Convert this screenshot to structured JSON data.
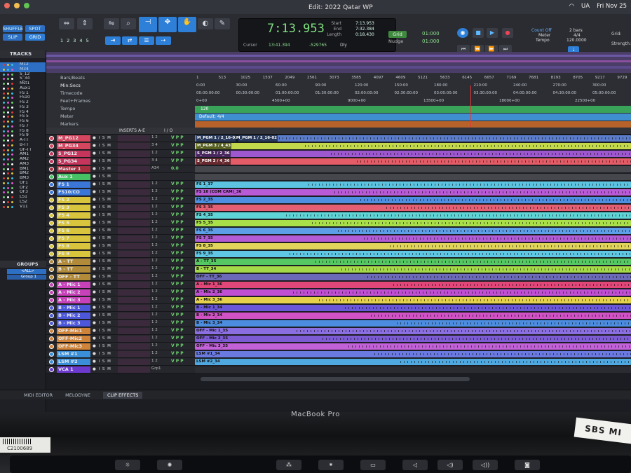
{
  "menubar": {
    "window_title": "Edit: 2022 Qatar WP",
    "status_items": [
      "UA",
      "Fri Nov 25"
    ]
  },
  "toolbar": {
    "edit_modes": [
      "SHUFFLE",
      "SPOT",
      "SLIP",
      "GRID"
    ],
    "zoom_presets": [
      "1",
      "2",
      "3",
      "4",
      "5"
    ],
    "counter": {
      "main": "7:13.953",
      "start_label": "Start",
      "end_label": "End",
      "length_label": "Length",
      "start": "7:13.953",
      "end": "7:32.384",
      "length": "0:18.430",
      "cursor_label": "Cursor",
      "cursor": "13:41.394",
      "offset": "-529765",
      "dly_label": "Dly"
    },
    "grid": {
      "grid_label": "Grid",
      "grid_value": "01:000",
      "nudge_label": "Nudge",
      "nudge_value": "01:000"
    },
    "tempo": {
      "count_off": "Count Off",
      "bars": "2 bars",
      "meter_label": "Meter",
      "meter": "4/4",
      "tempo_label": "Tempo",
      "tempo": "120.0000"
    },
    "right_labels": [
      "Grid:",
      "Strength:"
    ]
  },
  "left_panel": {
    "tracks_title": "TRACKS",
    "tracks": [
      "M12",
      "M34",
      "S_12",
      "S_34",
      "Mst1",
      "Aux1",
      "FS 1",
      "FS10",
      "FS 2",
      "FS 3",
      "FS 4",
      "FS 5",
      "FS 6",
      "FS 7",
      "FS 8",
      "FS 9",
      "A-TT",
      "B-TT",
      "OF-TT",
      "AM1",
      "AM2",
      "AM3",
      "BM1",
      "BM2",
      "BM3",
      "OF1",
      "OF2",
      "OF3",
      "LS1",
      "LS2",
      "V11"
    ],
    "groups_title": "GROUPS",
    "groups": [
      "<ALL>",
      "Group 1"
    ]
  },
  "rulers": {
    "labels": [
      "Bars/Beats",
      "Min:Secs",
      "Timecode",
      "Feet+Frames",
      "Tempo",
      "Meter",
      "Markers"
    ],
    "bars": [
      "1",
      "513",
      "1025",
      "1537",
      "2049",
      "2561",
      "3073",
      "3585",
      "4097",
      "4609",
      "5121",
      "5633",
      "6145",
      "6657",
      "7169",
      "7681",
      "8193",
      "8705",
      "9217",
      "9729",
      "10241"
    ],
    "minsecs": [
      "0:00",
      "30:00",
      "60:00",
      "90:00",
      "120:00",
      "150:00",
      "180:00",
      "210:00",
      "240:00",
      "270:00",
      "300:00",
      "330:00"
    ],
    "timecode": [
      "00:00:00:00",
      "00:30:00:00",
      "01:00:00:00",
      "01:30:00:00",
      "02:00:00:00",
      "02:30:00:00",
      "03:00:00:00",
      "03:30:00:00",
      "04:00:00:00",
      "04:30:00:00",
      "05:00:00:00",
      "05:30:00:00"
    ],
    "feet": [
      "0+00",
      "4500+00",
      "9000+00",
      "13500+00",
      "18000+00",
      "22500+00",
      "27000+00"
    ],
    "tempo_value": "120",
    "meter_value": "Default: 4/4"
  },
  "edit_header": {
    "inserts_label": "INSERTS A-E",
    "io_label": "I / O"
  },
  "tracks": [
    {
      "name": "M_PG12",
      "color": "#d4455e",
      "clip": "M_PGM 1 / 2_16-02",
      "clip2": "M_PGM 1 / 2_16-02",
      "lane": "#5a7cc9",
      "io": "1 2",
      "v": "V P P"
    },
    {
      "name": "M_PG34",
      "color": "#d4455e",
      "clip": "M_PGM 3 / 4_43",
      "lane": "#c3d84a",
      "io": "3 4",
      "v": "V P P"
    },
    {
      "name": "S_PG12",
      "color": "#c5355c",
      "clip": "S_PGM 1 / 2_36",
      "lane": "#9d58cf",
      "io": "1 2",
      "v": "V P P"
    },
    {
      "name": "S_PG34",
      "color": "#c5355c",
      "clip": "S_PGM 3 / 4_36",
      "lane": "#e45c67",
      "io": "3 4",
      "v": "V P P"
    },
    {
      "name": "Master 1",
      "color": "#a82f3f",
      "clip": "",
      "lane": "#45474d",
      "io": "A34",
      "v": "0.0"
    },
    {
      "name": "Aux 1",
      "color": "#46c163",
      "clip": "",
      "lane": "#45474d",
      "io": "",
      "v": ""
    },
    {
      "name": "FS 1",
      "color": "#3a77d8",
      "clip": "FS 1_37",
      "lane": "#5cc3e0",
      "io": "1 2",
      "v": "V P P"
    },
    {
      "name": "FS10/CO",
      "color": "#3a77d8",
      "clip": "FS 10 (COM CAM)_36",
      "lane": "#b95bd6",
      "io": "1 2",
      "v": "V P P"
    },
    {
      "name": "FS 2",
      "color": "#d9c53d",
      "clip": "FS 2_35",
      "lane": "#4d8fe0",
      "io": "1 2",
      "v": "V P P"
    },
    {
      "name": "FS 3",
      "color": "#d9c53d",
      "clip": "FS 3_35",
      "lane": "#e55f73",
      "io": "1 2",
      "v": "V P P"
    },
    {
      "name": "FS 4",
      "color": "#d9c53d",
      "clip": "FS 4_35",
      "lane": "#5fd4d6",
      "io": "1 2",
      "v": "V P P"
    },
    {
      "name": "FS 5",
      "color": "#d9c53d",
      "clip": "FS 5_35",
      "lane": "#a9e04a",
      "io": "1 2",
      "v": "V P P"
    },
    {
      "name": "FS 6",
      "color": "#d9c53d",
      "clip": "FS 6_35",
      "lane": "#5c9fe6",
      "io": "1 2",
      "v": "V P P"
    },
    {
      "name": "FS 7",
      "color": "#d9c53d",
      "clip": "FS 7_35",
      "lane": "#b25bd5",
      "io": "1 2",
      "v": "V P P"
    },
    {
      "name": "FS 8",
      "color": "#d9c53d",
      "clip": "FS 8_35",
      "lane": "#e0d55a",
      "io": "1 2",
      "v": "V P P"
    },
    {
      "name": "FS 9",
      "color": "#d9c53d",
      "clip": "FS 9_35",
      "lane": "#5fc6e3",
      "io": "1 2",
      "v": "V P P"
    },
    {
      "name": "A - TT",
      "color": "#b18a3a",
      "clip": "A - TT_35",
      "lane": "#55c863",
      "io": "1 2",
      "v": "V P P"
    },
    {
      "name": "B - TT",
      "color": "#b18a3a",
      "clip": "B - TT_34",
      "lane": "#a4d948",
      "io": "1 2",
      "v": "V P P"
    },
    {
      "name": "OFF - TT",
      "color": "#b18a3a",
      "clip": "OFF - TT_36",
      "lane": "#6c6ab8",
      "io": "1 2",
      "v": "V P P"
    },
    {
      "name": "A - Mic 1",
      "color": "#c742b8",
      "clip": "A - Mic 1_36",
      "lane": "#e2477a",
      "io": "1 2",
      "v": "V P P"
    },
    {
      "name": "A - Mic 2",
      "color": "#c742b8",
      "clip": "A - Mic 2_36",
      "lane": "#c04fd3",
      "io": "1 2",
      "v": "V P P"
    },
    {
      "name": "A - Mic 3",
      "color": "#c742b8",
      "clip": "A - Mic 3_36",
      "lane": "#e5d24a",
      "io": "1 2",
      "v": "V P P"
    },
    {
      "name": "B - Mic 1",
      "color": "#4d57d9",
      "clip": "B - Mic 1_34",
      "lane": "#6a56d8",
      "io": "1 2",
      "v": "V P P"
    },
    {
      "name": "B - Mic 2",
      "color": "#4d57d9",
      "clip": "B - Mic 2_34",
      "lane": "#d152c4",
      "io": "1 2",
      "v": "V P P"
    },
    {
      "name": "B - Mic 3",
      "color": "#4d57d9",
      "clip": "B - Mic 3_34",
      "lane": "#4d8de0",
      "io": "1 2",
      "v": "V P P"
    },
    {
      "name": "OFF-Mic1",
      "color": "#d0843a",
      "clip": "OFF - Mic 1_35",
      "lane": "#8b6ee0",
      "io": "1 2",
      "v": "V P P"
    },
    {
      "name": "OFF-Mic2",
      "color": "#d0843a",
      "clip": "OFF - Mic 2_35",
      "lane": "#7c5bd3",
      "io": "1 2",
      "v": "V P P"
    },
    {
      "name": "OFF-Mic3",
      "color": "#d0843a",
      "clip": "OFF - Mic 3_35",
      "lane": "#c361d8",
      "io": "1 2",
      "v": "V P P"
    },
    {
      "name": "LSM #1",
      "color": "#3a8fd8",
      "clip": "LSM #1_34",
      "lane": "#6a7ae0",
      "io": "1 2",
      "v": "V P P"
    },
    {
      "name": "LSM #2",
      "color": "#3a8fd8",
      "clip": "LSM #2_34",
      "lane": "#4fa8e0",
      "io": "1 2",
      "v": "V P P"
    },
    {
      "name": "VCA 1",
      "color": "#6d3ad0",
      "clip": "",
      "lane": "#2a2c31",
      "io": "Grp1",
      "v": ""
    }
  ],
  "bottom_tabs": [
    "MIDI EDITOR",
    "MELODYNE",
    "CLIP EFFECTS"
  ],
  "bezel": {
    "brand": "MacBook Pro",
    "label": "SBS MI",
    "asset": "C2100689"
  }
}
